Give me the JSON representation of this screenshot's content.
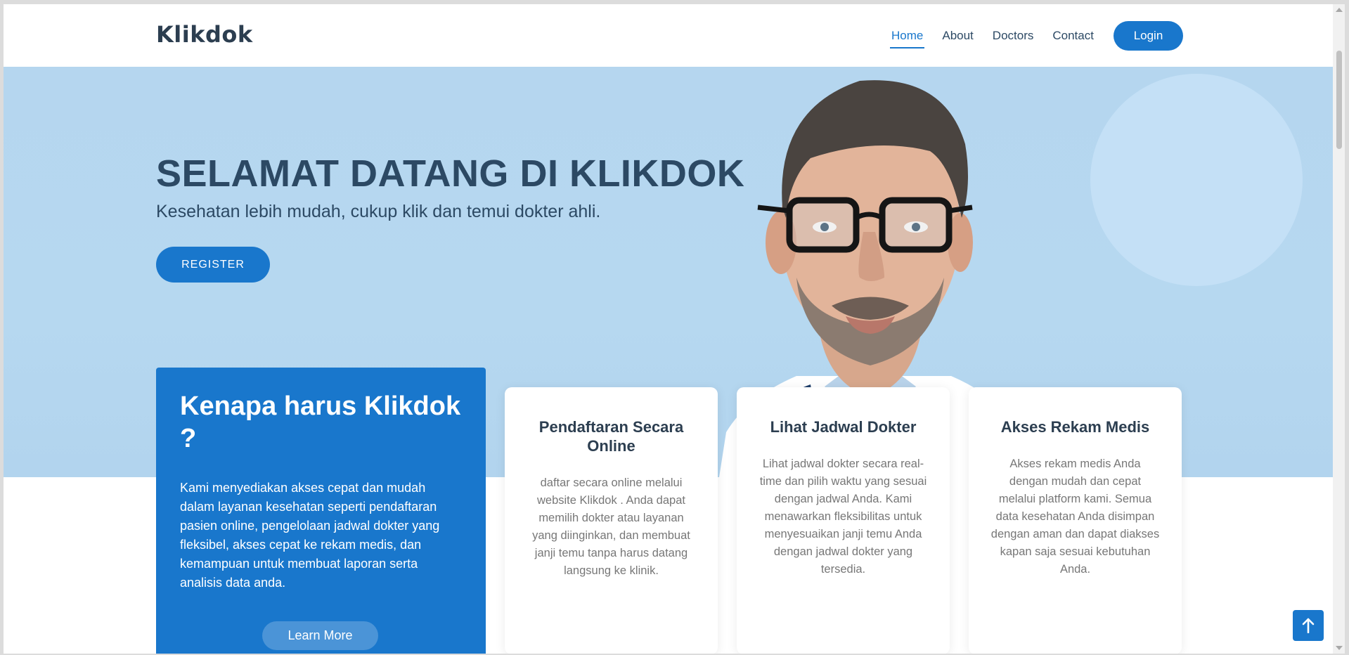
{
  "header": {
    "logo": "Klikdok",
    "nav": [
      {
        "label": "Home"
      },
      {
        "label": "About"
      },
      {
        "label": "Doctors"
      },
      {
        "label": "Contact"
      }
    ],
    "login_label": "Login"
  },
  "hero": {
    "title": "SELAMAT DATANG DI KLIKDOK",
    "subtitle": "Kesehatan lebih mudah, cukup klik dan temui dokter ahli.",
    "register_label": "REGISTER"
  },
  "why": {
    "title": "Kenapa harus Klikdok ?",
    "text": "Kami menyediakan akses cepat dan mudah dalam layanan kesehatan seperti pendaftaran pasien online, pengelolaan jadwal dokter yang fleksibel, akses cepat ke rekam medis, dan kemampuan untuk membuat laporan serta analisis data anda.",
    "button_label": "Learn More"
  },
  "cards": [
    {
      "title": "Pendaftaran Secara Online",
      "text": "daftar secara online melalui website Klikdok . Anda dapat memilih dokter atau layanan yang diinginkan, dan membuat janji temu tanpa harus datang langsung ke klinik."
    },
    {
      "title": "Lihat Jadwal Dokter",
      "text": "Lihat jadwal dokter secara real-time dan pilih waktu yang sesuai dengan jadwal Anda. Kami menawarkan fleksibilitas untuk menyesuaikan janji temu Anda dengan jadwal dokter yang tersedia."
    },
    {
      "title": "Akses Rekam Medis",
      "text": "Akses rekam medis Anda dengan mudah dan cepat melalui platform kami. Semua data kesehatan Anda disimpan dengan aman dan dapat diakses kapan saja sesuai kebutuhan Anda."
    }
  ],
  "colors": {
    "accent": "#1977cc",
    "heading": "#2c4964",
    "hero_bg": "#b5d6ef"
  },
  "icons": {
    "back_to_top": "arrow-up-icon"
  }
}
